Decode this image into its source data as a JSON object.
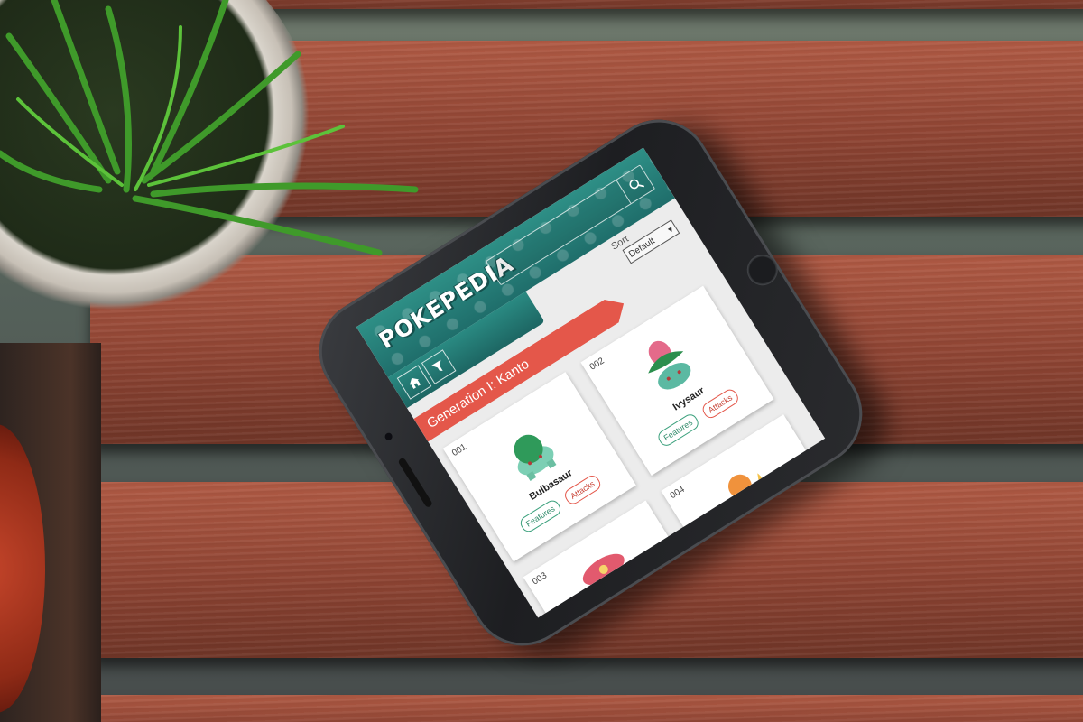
{
  "app": {
    "logo": "POKEPEDIA",
    "search": {
      "placeholder": ""
    }
  },
  "sort": {
    "label": "Sort",
    "selected": "Default"
  },
  "generation": {
    "title": "Generation I: Kanto"
  },
  "pokemon": [
    {
      "number": "001",
      "name": "Bulbasaur",
      "features_label": "Features",
      "attacks_label": "Attacks"
    },
    {
      "number": "002",
      "name": "Ivysaur",
      "features_label": "Features",
      "attacks_label": "Attacks"
    },
    {
      "number": "003",
      "name": "",
      "features_label": "",
      "attacks_label": ""
    },
    {
      "number": "004",
      "name": "",
      "features_label": "",
      "attacks_label": ""
    }
  ],
  "colors": {
    "header_teal": "#1f6e6b",
    "banner_red": "#e4574a",
    "features_green": "#3aa07c",
    "attacks_red": "#e4574a"
  },
  "icons": [
    "search-icon",
    "home-icon",
    "filter-icon",
    "chevron-down-icon"
  ]
}
